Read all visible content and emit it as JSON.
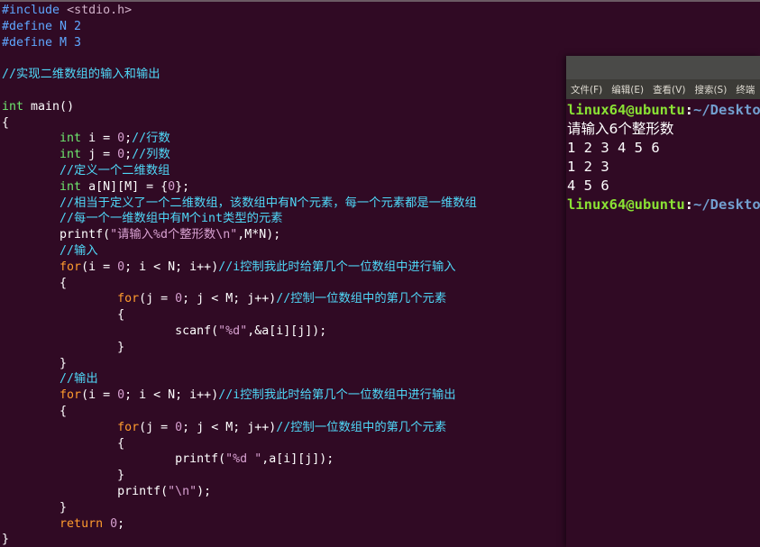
{
  "editor": {
    "lines": [
      [
        {
          "t": "#include ",
          "c": "pre"
        },
        {
          "t": "<stdio.h>",
          "c": "inc"
        }
      ],
      [
        {
          "t": "#define ",
          "c": "pre"
        },
        {
          "t": "N 2",
          "c": "pre"
        }
      ],
      [
        {
          "t": "#define ",
          "c": "pre"
        },
        {
          "t": "M 3",
          "c": "pre"
        }
      ],
      [],
      [
        {
          "t": "//实现二维数组的输入和输出",
          "c": "cmt"
        }
      ],
      [],
      [
        {
          "t": "int",
          "c": "type"
        },
        {
          "t": " main()",
          "c": "plain"
        }
      ],
      [
        {
          "t": "{",
          "c": "plain"
        }
      ],
      [
        {
          "t": "        ",
          "c": "plain"
        },
        {
          "t": "int",
          "c": "type"
        },
        {
          "t": " i = ",
          "c": "plain"
        },
        {
          "t": "0",
          "c": "num"
        },
        {
          "t": ";",
          "c": "plain"
        },
        {
          "t": "//行数",
          "c": "cmt"
        }
      ],
      [
        {
          "t": "        ",
          "c": "plain"
        },
        {
          "t": "int",
          "c": "type"
        },
        {
          "t": " j = ",
          "c": "plain"
        },
        {
          "t": "0",
          "c": "num"
        },
        {
          "t": ";",
          "c": "plain"
        },
        {
          "t": "//列数",
          "c": "cmt"
        }
      ],
      [
        {
          "t": "        ",
          "c": "plain"
        },
        {
          "t": "//定义一个二维数组",
          "c": "cmt"
        }
      ],
      [
        {
          "t": "        ",
          "c": "plain"
        },
        {
          "t": "int",
          "c": "type"
        },
        {
          "t": " a[N][M] = {",
          "c": "plain"
        },
        {
          "t": "0",
          "c": "num"
        },
        {
          "t": "};",
          "c": "plain"
        }
      ],
      [
        {
          "t": "        ",
          "c": "plain"
        },
        {
          "t": "//相当于定义了一个二维数组，该数组中有N个元素，每一个元素都是一维数组",
          "c": "cmt"
        }
      ],
      [
        {
          "t": "        ",
          "c": "plain"
        },
        {
          "t": "//每一个一维数组中有M个int类型的元素",
          "c": "cmt"
        }
      ],
      [
        {
          "t": "        printf(",
          "c": "plain"
        },
        {
          "t": "\"请输入%d个整形数\\n\"",
          "c": "str"
        },
        {
          "t": ",M*N)",
          "c": "plain"
        },
        {
          "t": ";",
          "c": "cursor"
        }
      ],
      [
        {
          "t": "        ",
          "c": "plain"
        },
        {
          "t": "//输入",
          "c": "cmt"
        }
      ],
      [
        {
          "t": "        ",
          "c": "plain"
        },
        {
          "t": "for",
          "c": "kw"
        },
        {
          "t": "(i = ",
          "c": "plain"
        },
        {
          "t": "0",
          "c": "num"
        },
        {
          "t": "; i < N; i++)",
          "c": "plain"
        },
        {
          "t": "//i控制我此时给第几个一位数组中进行输入",
          "c": "cmt"
        }
      ],
      [
        {
          "t": "        {",
          "c": "plain"
        }
      ],
      [
        {
          "t": "                ",
          "c": "plain"
        },
        {
          "t": "for",
          "c": "kw"
        },
        {
          "t": "(j = ",
          "c": "plain"
        },
        {
          "t": "0",
          "c": "num"
        },
        {
          "t": "; j < M; j++)",
          "c": "plain"
        },
        {
          "t": "//控制一位数组中的第几个元素",
          "c": "cmt"
        }
      ],
      [
        {
          "t": "                {",
          "c": "plain"
        }
      ],
      [
        {
          "t": "                        scanf(",
          "c": "plain"
        },
        {
          "t": "\"%d\"",
          "c": "str"
        },
        {
          "t": ",&a[i][j]);",
          "c": "plain"
        }
      ],
      [
        {
          "t": "                }",
          "c": "plain"
        }
      ],
      [
        {
          "t": "        }",
          "c": "plain"
        }
      ],
      [
        {
          "t": "        ",
          "c": "plain"
        },
        {
          "t": "//输出",
          "c": "cmt"
        }
      ],
      [
        {
          "t": "        ",
          "c": "plain"
        },
        {
          "t": "for",
          "c": "kw"
        },
        {
          "t": "(i = ",
          "c": "plain"
        },
        {
          "t": "0",
          "c": "num"
        },
        {
          "t": "; i < N; i++)",
          "c": "plain"
        },
        {
          "t": "//i控制我此时给第几个一位数组中进行输出",
          "c": "cmt"
        }
      ],
      [
        {
          "t": "        {",
          "c": "plain"
        }
      ],
      [
        {
          "t": "                ",
          "c": "plain"
        },
        {
          "t": "for",
          "c": "kw"
        },
        {
          "t": "(j = ",
          "c": "plain"
        },
        {
          "t": "0",
          "c": "num"
        },
        {
          "t": "; j < M; j++)",
          "c": "plain"
        },
        {
          "t": "//控制一位数组中的第几个元素",
          "c": "cmt"
        }
      ],
      [
        {
          "t": "                {",
          "c": "plain"
        }
      ],
      [
        {
          "t": "                        printf(",
          "c": "plain"
        },
        {
          "t": "\"%d \"",
          "c": "str"
        },
        {
          "t": ",a[i][j]);",
          "c": "plain"
        }
      ],
      [
        {
          "t": "                }",
          "c": "plain"
        }
      ],
      [
        {
          "t": "                printf(",
          "c": "plain"
        },
        {
          "t": "\"\\n\"",
          "c": "str"
        },
        {
          "t": ");",
          "c": "plain"
        }
      ],
      [
        {
          "t": "        }",
          "c": "plain"
        }
      ],
      [
        {
          "t": "        ",
          "c": "plain"
        },
        {
          "t": "return",
          "c": "kw"
        },
        {
          "t": " ",
          "c": "plain"
        },
        {
          "t": "0",
          "c": "num"
        },
        {
          "t": ";",
          "c": "plain"
        }
      ],
      [
        {
          "t": "}",
          "c": "plain"
        }
      ]
    ]
  },
  "terminal": {
    "menu": [
      "文件(F)",
      "编辑(E)",
      "查看(V)",
      "搜索(S)",
      "终端"
    ],
    "prompt_user": "linux64@ubuntu",
    "prompt_colon": ":",
    "prompt_path": "~/Deskto",
    "output": [
      "请输入6个整形数",
      "1 2 3 4 5 6",
      "1 2 3",
      "4 5 6"
    ],
    "prompt2_user": "linux64@ubuntu",
    "prompt2_colon": ":",
    "prompt2_path": "~/Deskto"
  },
  "colors": {
    "background": "#300a24",
    "preprocessor": "#5fa7ff",
    "type": "#6ee86e",
    "keyword": "#ff9b2e",
    "number_string": "#d7a0d0",
    "comment": "#4fd7f7",
    "prompt_user": "#8ae234",
    "prompt_path": "#729fcf"
  }
}
